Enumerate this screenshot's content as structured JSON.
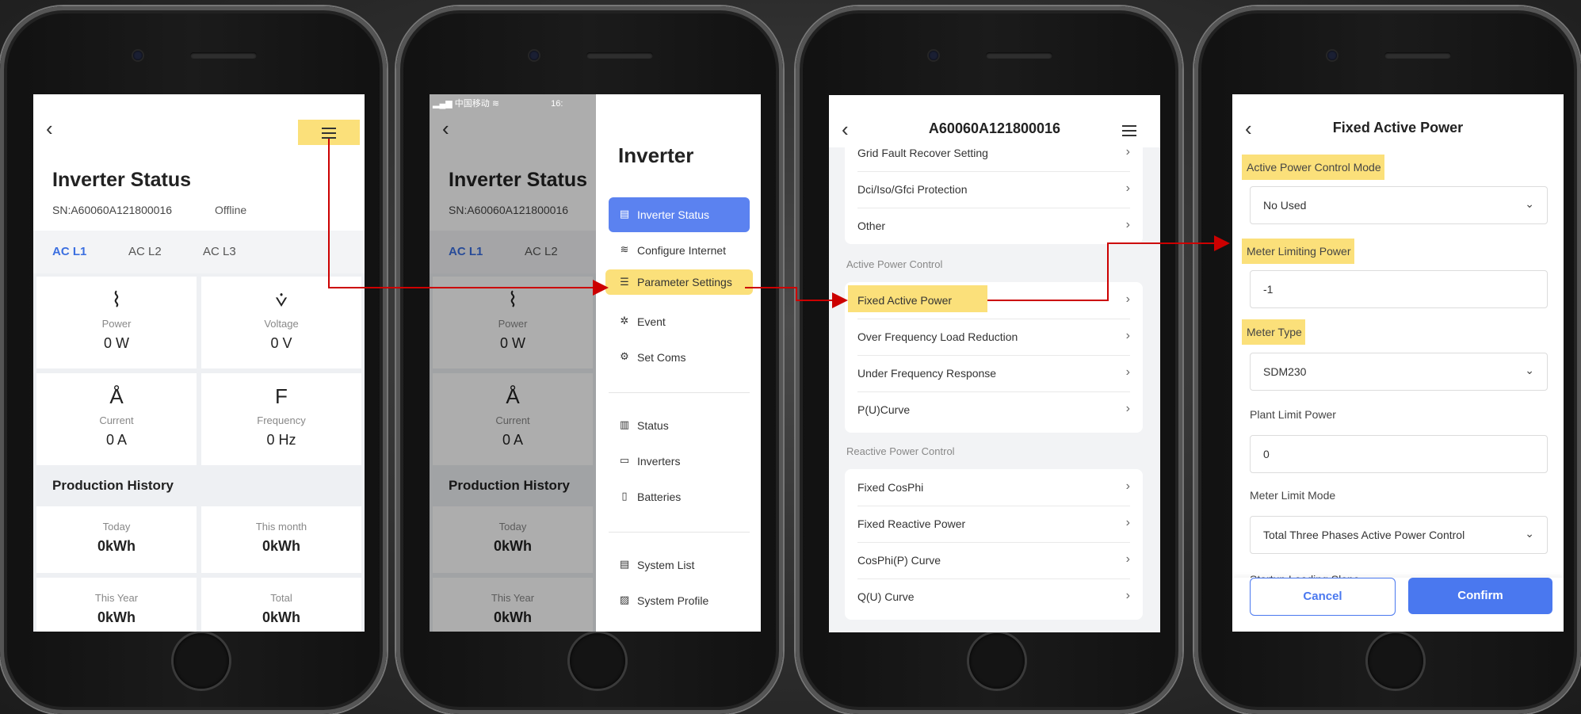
{
  "screen1": {
    "title": "Inverter Status",
    "sn": "SN:A60060A121800016",
    "status": "Offline",
    "tabs": [
      "AC L1",
      "AC L2",
      "AC L3"
    ],
    "metrics": [
      {
        "icon": "power-icon",
        "glyph": "⌇",
        "label": "Power",
        "value": "0 W"
      },
      {
        "icon": "voltage-icon",
        "glyph": "⩒",
        "label": "Voltage",
        "value": "0 V"
      },
      {
        "icon": "current-icon",
        "glyph": "Å",
        "label": "Current",
        "value": "0 A"
      },
      {
        "icon": "frequency-icon",
        "glyph": "F",
        "label": "Frequency",
        "value": "0 Hz"
      }
    ],
    "production_title": "Production History",
    "production": [
      {
        "label": "Today",
        "value": "0kWh"
      },
      {
        "label": "This month",
        "value": "0kWh"
      },
      {
        "label": "This Year",
        "value": "0kWh"
      },
      {
        "label": "Total",
        "value": "0kWh"
      }
    ]
  },
  "screen2": {
    "statusbar": "中国移动",
    "time": "16:",
    "drawer_title": "Inverter",
    "menu": [
      {
        "icon": "inverter-status-icon",
        "glyph": "▤",
        "label": "Inverter Status"
      },
      {
        "icon": "wifi-icon",
        "glyph": "≋",
        "label": "Configure Internet"
      },
      {
        "icon": "sliders-icon",
        "glyph": "☰",
        "label": "Parameter Settings"
      },
      {
        "icon": "bug-icon",
        "glyph": "✲",
        "label": "Event"
      },
      {
        "icon": "gear-icon",
        "glyph": "⚙",
        "label": "Set Coms"
      },
      {
        "icon": "status-icon",
        "glyph": "▥",
        "label": "Status"
      },
      {
        "icon": "monitor-icon",
        "glyph": "▭",
        "label": "Inverters"
      },
      {
        "icon": "battery-icon",
        "glyph": "▯",
        "label": "Batteries"
      },
      {
        "icon": "list-icon",
        "glyph": "▤",
        "label": "System List"
      },
      {
        "icon": "profile-icon",
        "glyph": "▨",
        "label": "System Profile"
      }
    ],
    "behind": {
      "title": "Inverter Status",
      "sn": "SN:A60060A121800016",
      "tab1": "AC L1",
      "tab2": "AC L2",
      "power_label": "Power",
      "power_value": "0 W",
      "current_label": "Current",
      "current_value": "0 A",
      "production_title": "Production History",
      "today_label": "Today",
      "today_value": "0kWh",
      "year_label": "This Year",
      "year_value": "0kWh"
    }
  },
  "screen3": {
    "title": "A60060A121800016",
    "top_rows": [
      "Grid Fault Recover Setting",
      "Dci/Iso/Gfci Protection",
      "Other"
    ],
    "group1": "Active Power Control",
    "active_rows": [
      "Fixed Active Power",
      "Over Frequency Load Reduction",
      "Under Frequency Response",
      "P(U)Curve"
    ],
    "group2": "Reactive Power Control",
    "reactive_rows": [
      "Fixed CosPhi",
      "Fixed Reactive Power",
      "CosPhi(P) Curve",
      "Q(U) Curve"
    ]
  },
  "screen4": {
    "title": "Fixed Active Power",
    "fields": [
      {
        "label": "Active Power Control Mode",
        "value": "No Used",
        "dropdown": true
      },
      {
        "label": "Meter Limiting Power",
        "value": "-1",
        "dropdown": false
      },
      {
        "label": "Meter Type",
        "value": "SDM230",
        "dropdown": true
      },
      {
        "label": "Plant Limit Power",
        "value": "0",
        "dropdown": false
      },
      {
        "label": "Meter Limit Mode",
        "value": "Total Three Phases Active Power Control",
        "dropdown": true
      }
    ],
    "next_label": "Startup Loading Slope",
    "cancel": "Cancel",
    "confirm": "Confirm"
  },
  "colors": {
    "accent": "#4a78ef",
    "highlight": "#fbe07a",
    "arrow": "#cc0000"
  }
}
